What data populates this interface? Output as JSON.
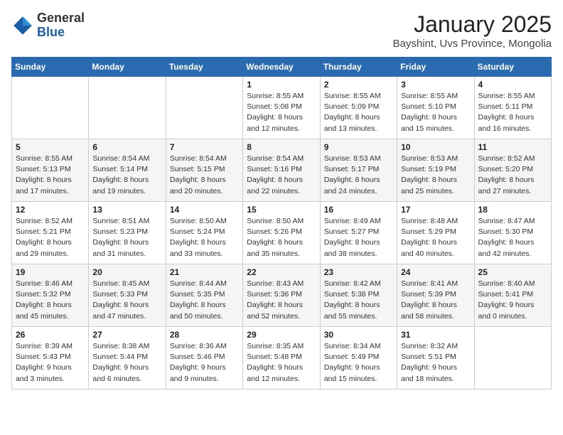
{
  "header": {
    "logo_general": "General",
    "logo_blue": "Blue",
    "month_year": "January 2025",
    "location": "Bayshint, Uvs Province, Mongolia"
  },
  "weekdays": [
    "Sunday",
    "Monday",
    "Tuesday",
    "Wednesday",
    "Thursday",
    "Friday",
    "Saturday"
  ],
  "weeks": [
    [
      {
        "day": "",
        "info": ""
      },
      {
        "day": "",
        "info": ""
      },
      {
        "day": "",
        "info": ""
      },
      {
        "day": "1",
        "info": "Sunrise: 8:55 AM\nSunset: 5:08 PM\nDaylight: 8 hours\nand 12 minutes."
      },
      {
        "day": "2",
        "info": "Sunrise: 8:55 AM\nSunset: 5:09 PM\nDaylight: 8 hours\nand 13 minutes."
      },
      {
        "day": "3",
        "info": "Sunrise: 8:55 AM\nSunset: 5:10 PM\nDaylight: 8 hours\nand 15 minutes."
      },
      {
        "day": "4",
        "info": "Sunrise: 8:55 AM\nSunset: 5:11 PM\nDaylight: 8 hours\nand 16 minutes."
      }
    ],
    [
      {
        "day": "5",
        "info": "Sunrise: 8:55 AM\nSunset: 5:13 PM\nDaylight: 8 hours\nand 17 minutes."
      },
      {
        "day": "6",
        "info": "Sunrise: 8:54 AM\nSunset: 5:14 PM\nDaylight: 8 hours\nand 19 minutes."
      },
      {
        "day": "7",
        "info": "Sunrise: 8:54 AM\nSunset: 5:15 PM\nDaylight: 8 hours\nand 20 minutes."
      },
      {
        "day": "8",
        "info": "Sunrise: 8:54 AM\nSunset: 5:16 PM\nDaylight: 8 hours\nand 22 minutes."
      },
      {
        "day": "9",
        "info": "Sunrise: 8:53 AM\nSunset: 5:17 PM\nDaylight: 8 hours\nand 24 minutes."
      },
      {
        "day": "10",
        "info": "Sunrise: 8:53 AM\nSunset: 5:19 PM\nDaylight: 8 hours\nand 25 minutes."
      },
      {
        "day": "11",
        "info": "Sunrise: 8:52 AM\nSunset: 5:20 PM\nDaylight: 8 hours\nand 27 minutes."
      }
    ],
    [
      {
        "day": "12",
        "info": "Sunrise: 8:52 AM\nSunset: 5:21 PM\nDaylight: 8 hours\nand 29 minutes."
      },
      {
        "day": "13",
        "info": "Sunrise: 8:51 AM\nSunset: 5:23 PM\nDaylight: 8 hours\nand 31 minutes."
      },
      {
        "day": "14",
        "info": "Sunrise: 8:50 AM\nSunset: 5:24 PM\nDaylight: 8 hours\nand 33 minutes."
      },
      {
        "day": "15",
        "info": "Sunrise: 8:50 AM\nSunset: 5:26 PM\nDaylight: 8 hours\nand 35 minutes."
      },
      {
        "day": "16",
        "info": "Sunrise: 8:49 AM\nSunset: 5:27 PM\nDaylight: 8 hours\nand 38 minutes."
      },
      {
        "day": "17",
        "info": "Sunrise: 8:48 AM\nSunset: 5:29 PM\nDaylight: 8 hours\nand 40 minutes."
      },
      {
        "day": "18",
        "info": "Sunrise: 8:47 AM\nSunset: 5:30 PM\nDaylight: 8 hours\nand 42 minutes."
      }
    ],
    [
      {
        "day": "19",
        "info": "Sunrise: 8:46 AM\nSunset: 5:32 PM\nDaylight: 8 hours\nand 45 minutes."
      },
      {
        "day": "20",
        "info": "Sunrise: 8:45 AM\nSunset: 5:33 PM\nDaylight: 8 hours\nand 47 minutes."
      },
      {
        "day": "21",
        "info": "Sunrise: 8:44 AM\nSunset: 5:35 PM\nDaylight: 8 hours\nand 50 minutes."
      },
      {
        "day": "22",
        "info": "Sunrise: 8:43 AM\nSunset: 5:36 PM\nDaylight: 8 hours\nand 52 minutes."
      },
      {
        "day": "23",
        "info": "Sunrise: 8:42 AM\nSunset: 5:38 PM\nDaylight: 8 hours\nand 55 minutes."
      },
      {
        "day": "24",
        "info": "Sunrise: 8:41 AM\nSunset: 5:39 PM\nDaylight: 8 hours\nand 58 minutes."
      },
      {
        "day": "25",
        "info": "Sunrise: 8:40 AM\nSunset: 5:41 PM\nDaylight: 9 hours\nand 0 minutes."
      }
    ],
    [
      {
        "day": "26",
        "info": "Sunrise: 8:39 AM\nSunset: 5:43 PM\nDaylight: 9 hours\nand 3 minutes."
      },
      {
        "day": "27",
        "info": "Sunrise: 8:38 AM\nSunset: 5:44 PM\nDaylight: 9 hours\nand 6 minutes."
      },
      {
        "day": "28",
        "info": "Sunrise: 8:36 AM\nSunset: 5:46 PM\nDaylight: 9 hours\nand 9 minutes."
      },
      {
        "day": "29",
        "info": "Sunrise: 8:35 AM\nSunset: 5:48 PM\nDaylight: 9 hours\nand 12 minutes."
      },
      {
        "day": "30",
        "info": "Sunrise: 8:34 AM\nSunset: 5:49 PM\nDaylight: 9 hours\nand 15 minutes."
      },
      {
        "day": "31",
        "info": "Sunrise: 8:32 AM\nSunset: 5:51 PM\nDaylight: 9 hours\nand 18 minutes."
      },
      {
        "day": "",
        "info": ""
      }
    ]
  ]
}
